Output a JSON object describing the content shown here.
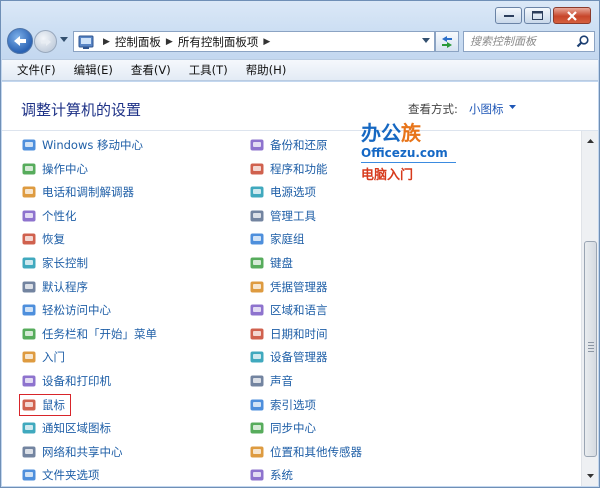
{
  "window": {
    "caption_buttons": [
      "minimize",
      "maximize",
      "close"
    ]
  },
  "nav": {
    "breadcrumbs": [
      "控制面板",
      "所有控制面板项"
    ],
    "search_placeholder": "搜索控制面板"
  },
  "menu": [
    "文件(F)",
    "编辑(E)",
    "查看(V)",
    "工具(T)",
    "帮助(H)"
  ],
  "header": {
    "title": "调整计算机的设置",
    "view_by_label": "查看方式:",
    "view_by_value": "小图标"
  },
  "items_left": [
    {
      "label": "Windows 移动中心",
      "icon": "mobility-center-icon"
    },
    {
      "label": "操作中心",
      "icon": "action-center-flag-icon"
    },
    {
      "label": "电话和调制解调器",
      "icon": "phone-modem-icon"
    },
    {
      "label": "个性化",
      "icon": "personalization-icon"
    },
    {
      "label": "恢复",
      "icon": "recovery-icon"
    },
    {
      "label": "家长控制",
      "icon": "parental-controls-icon"
    },
    {
      "label": "默认程序",
      "icon": "default-programs-icon"
    },
    {
      "label": "轻松访问中心",
      "icon": "ease-of-access-icon"
    },
    {
      "label": "任务栏和「开始」菜单",
      "icon": "taskbar-icon"
    },
    {
      "label": "入门",
      "icon": "getting-started-icon"
    },
    {
      "label": "设备和打印机",
      "icon": "printer-icon"
    },
    {
      "label": "鼠标",
      "icon": "mouse-icon",
      "highlighted": true
    },
    {
      "label": "通知区域图标",
      "icon": "notification-area-icon"
    },
    {
      "label": "网络和共享中心",
      "icon": "network-icon"
    },
    {
      "label": "文件夹选项",
      "icon": "folder-options-icon"
    }
  ],
  "items_right": [
    {
      "label": "备份和还原",
      "icon": "backup-icon"
    },
    {
      "label": "程序和功能",
      "icon": "programs-features-icon"
    },
    {
      "label": "电源选项",
      "icon": "power-options-icon"
    },
    {
      "label": "管理工具",
      "icon": "admin-tools-icon"
    },
    {
      "label": "家庭组",
      "icon": "homegroup-icon"
    },
    {
      "label": "键盘",
      "icon": "keyboard-icon"
    },
    {
      "label": "凭据管理器",
      "icon": "credential-manager-icon"
    },
    {
      "label": "区域和语言",
      "icon": "region-language-icon"
    },
    {
      "label": "日期和时间",
      "icon": "date-time-icon"
    },
    {
      "label": "设备管理器",
      "icon": "device-manager-icon"
    },
    {
      "label": "声音",
      "icon": "sound-icon"
    },
    {
      "label": "索引选项",
      "icon": "indexing-icon"
    },
    {
      "label": "同步中心",
      "icon": "sync-center-icon"
    },
    {
      "label": "位置和其他传感器",
      "icon": "location-sensors-icon"
    },
    {
      "label": "系统",
      "icon": "system-icon"
    }
  ],
  "watermark": {
    "brand_a": "办公",
    "brand_b": "族",
    "site": "Officezu.com",
    "sub": "电脑入门"
  },
  "colors": {
    "link": "#1f5fa7",
    "title": "#1e3287",
    "highlight_border": "#d8252a"
  }
}
